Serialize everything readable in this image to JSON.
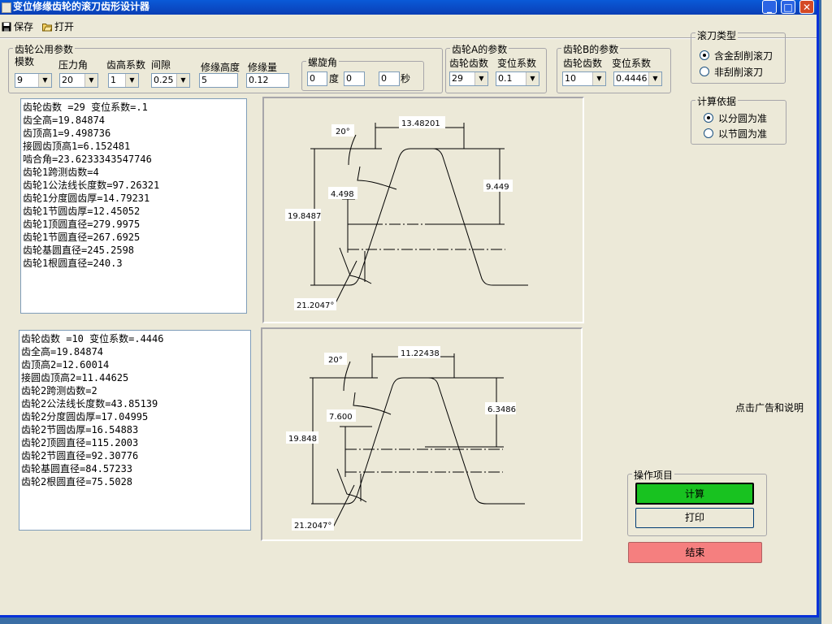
{
  "window": {
    "title": "变位修缘齿轮的滚刀齿形设计器",
    "minimize": "_",
    "maximize": "□",
    "close": "✕"
  },
  "toolbar": {
    "save_label": "保存",
    "open_label": "打开"
  },
  "common": {
    "group_title": "齿轮公用参数",
    "module_label": "模数",
    "module_value": "9",
    "pressure_label": "压力角",
    "pressure_value": "20",
    "addendum_label": "齿高系数",
    "addendum_value": "1",
    "clearance_label": "间隙",
    "clearance_value": "0.25",
    "tipheight_label": "修缘高度",
    "tipheight_value": "5",
    "tipamount_label": "修缘量",
    "tipamount_value": "0.12"
  },
  "helix": {
    "title": "螺旋角",
    "deg_value": "0",
    "deg_unit": "度",
    "min_value": "0",
    "sec_value": "0",
    "sec_unit": "秒"
  },
  "gearA": {
    "title": "齿轮A的参数",
    "teeth_label": "齿轮齿数",
    "teeth_value": "29",
    "shift_label": "变位系数",
    "shift_value": "0.1"
  },
  "gearB": {
    "title": "齿轮B的参数",
    "teeth_label": "齿轮齿数",
    "teeth_value": "10",
    "shift_label": "变位系数",
    "shift_value": "0.4446"
  },
  "hobtype": {
    "title": "滚刀类型",
    "opt1": "含金刮削滚刀",
    "opt2": "非刮削滚刀"
  },
  "basis": {
    "title": "计算依据",
    "opt1": "以分圆为准",
    "opt2": "以节圆为准"
  },
  "results1": [
    "齿轮齿数 =29   变位系数=.1",
    "齿全高=19.84874",
    "齿顶高1=9.498736",
    "接圆齿顶高1=6.152481",
    "啮合角=23.6233343547746",
    "齿轮1跨测齿数=4",
    "齿轮1公法线长度数=97.26321",
    "齿轮1分度圆齿厚=14.79231",
    "齿轮1节圆齿厚=12.45052",
    "齿轮1顶圆直径=279.9975",
    "齿轮1节圆直径=267.6925",
    "齿轮基圆直径=245.2598",
    "齿轮1根圆直径=240.3"
  ],
  "results2": [
    "齿轮齿数 =10   变位系数=.4446",
    "齿全高=19.84874",
    "齿顶高2=12.60014",
    "接圆齿顶高2=11.44625",
    "齿轮2跨测齿数=2",
    "齿轮2公法线长度数=43.85139",
    "齿轮2分度圆齿厚=17.04995",
    "齿轮2节圆齿厚=16.54883",
    "齿轮2顶圆直径=115.2003",
    "齿轮2节圆直径=92.30776",
    "齿轮基圆直径=84.57233",
    "齿轮2根圆直径=75.5028"
  ],
  "profile1": {
    "angle_top": "20°",
    "width": "13.48201",
    "height_right": "9.449",
    "height_mid": "4.498",
    "height_total": "19.8487",
    "angle_bottom": "21.2047°"
  },
  "profile2": {
    "angle_top": "20°",
    "width": "11.22438",
    "height_right": "6.3486",
    "height_mid": "7.600",
    "height_total": "19.848",
    "angle_bottom": "21.2047°"
  },
  "ad_text": "点击广告和说明",
  "ops": {
    "title": "操作项目",
    "calc": "计算",
    "print": "打印",
    "exit": "结束"
  },
  "colors": {
    "calc": "#18c220",
    "exit": "#f57f7f",
    "titlebar": "#0a4fc8"
  }
}
